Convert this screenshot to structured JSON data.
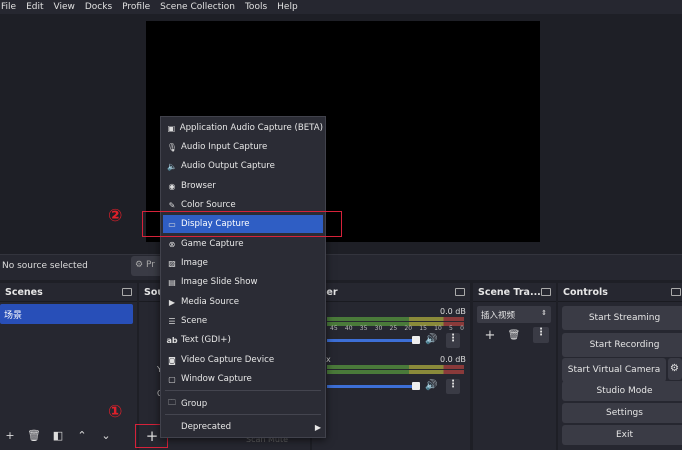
{
  "menubar": [
    "File",
    "Edit",
    "View",
    "Docks",
    "Profile",
    "Scene Collection",
    "Tools",
    "Help"
  ],
  "source_bar": {
    "no_source": "No source selected",
    "properties": "Pr"
  },
  "scenes": {
    "title": "Scenes",
    "items": [
      "场景"
    ]
  },
  "sources": {
    "title": "Sou",
    "side_labels": [
      "Y",
      "O"
    ],
    "tail_text": "Scan Mute"
  },
  "mixer": {
    "title": "ixer",
    "channel1": {
      "db": "0.0 dB"
    },
    "channel2": {
      "label": "x",
      "db": "0.0 dB"
    },
    "scale": [
      "45",
      "40",
      "35",
      "30",
      "25",
      "20",
      "15",
      "10",
      "5",
      "0"
    ]
  },
  "transitions": {
    "title": "Scene Tra...",
    "select_value": "插入视频"
  },
  "controls": {
    "title": "Controls",
    "buttons": [
      "Start Streaming",
      "Start Recording",
      "Start Virtual Camera",
      "Studio Mode",
      "Settings",
      "Exit"
    ]
  },
  "context_menu": {
    "items": [
      {
        "label": "Application Audio Capture (BETA)",
        "icon": "app-audio-icon"
      },
      {
        "label": "Audio Input Capture",
        "icon": "microphone-icon"
      },
      {
        "label": "Audio Output Capture",
        "icon": "speaker-icon"
      },
      {
        "label": "Browser",
        "icon": "globe-icon"
      },
      {
        "label": "Color Source",
        "icon": "brush-icon"
      },
      {
        "label": "Display Capture",
        "icon": "monitor-icon",
        "selected": true
      },
      {
        "label": "Game Capture",
        "icon": "gamepad-icon"
      },
      {
        "label": "Image",
        "icon": "image-icon"
      },
      {
        "label": "Image Slide Show",
        "icon": "slideshow-icon"
      },
      {
        "label": "Media Source",
        "icon": "play-icon"
      },
      {
        "label": "Scene",
        "icon": "list-icon"
      },
      {
        "label": "Text (GDI+)",
        "icon": "text-icon"
      },
      {
        "label": "Video Capture Device",
        "icon": "camera-icon"
      },
      {
        "label": "Window Capture",
        "icon": "window-icon"
      },
      {
        "label": "Group",
        "icon": "folder-icon"
      },
      {
        "label": "Deprecated",
        "icon": "none"
      }
    ]
  },
  "annotations": {
    "one": "①",
    "two": "②"
  },
  "colors": {
    "accent": "#2f5ec4",
    "highlight_red": "#d6223a",
    "panel": "#262730",
    "background": "#1e1f26"
  }
}
